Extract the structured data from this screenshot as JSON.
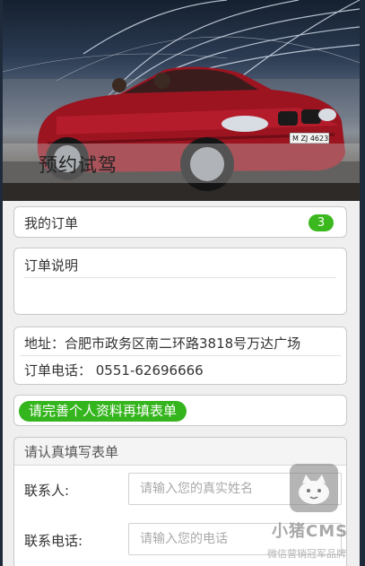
{
  "hero": {
    "title": "预约试驾",
    "image": "red-convertible-car-photo",
    "license_plate": "M ZJ 4623"
  },
  "orders": {
    "label": "我的订单",
    "count": "3",
    "badge_color": "#3ab81e"
  },
  "order_notes": {
    "label": "订单说明",
    "content": ""
  },
  "contact": {
    "address": "地址：合肥市政务区南二环路3818号万达广场",
    "phone": "订单电话： 0551-62696666"
  },
  "profile_prompt": {
    "text": "请完善个人资料再填表单",
    "color": "#35b51d"
  },
  "form": {
    "header": "请认真填写表单",
    "fields": [
      {
        "label": "联系人:",
        "placeholder": "请输入您的真实姓名",
        "value": ""
      },
      {
        "label": "联系电话:",
        "placeholder": "请输入您的电话",
        "value": ""
      }
    ]
  },
  "watermark": {
    "brand": "小猪CMS",
    "tagline": "微信营销冠军品牌",
    "icon": "pig-logo-icon"
  }
}
